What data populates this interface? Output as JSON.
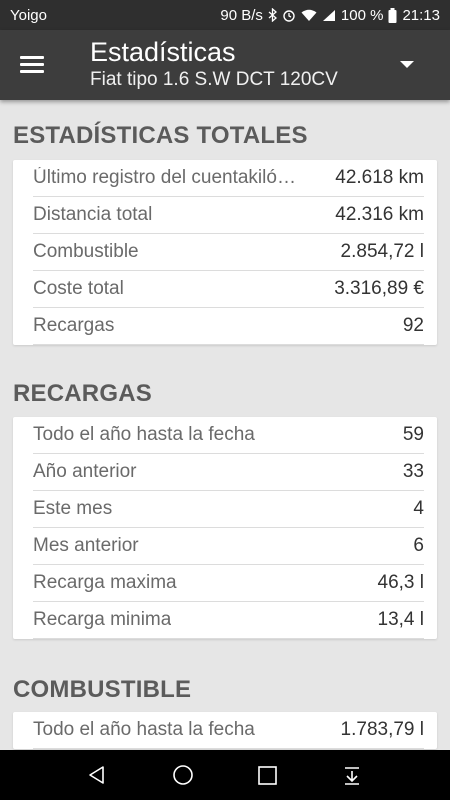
{
  "status_bar": {
    "carrier": "Yoigo",
    "speed": "90 B/s",
    "battery": "100 %",
    "time": "21:13",
    "icons": [
      "bluetooth-icon",
      "alarm-icon",
      "wifi-icon",
      "signal-icon",
      "battery-icon"
    ]
  },
  "app_bar": {
    "title": "Estadísticas",
    "subtitle": "Fiat tipo 1.6 S.W DCT 120CV",
    "menu_icon": "hamburger-menu-icon",
    "dropdown_icon": "dropdown-arrow-icon"
  },
  "sections": {
    "totales": {
      "title": "ESTADÍSTICAS TOTALES",
      "rows": [
        {
          "label": "Último registro del cuentakilómetros",
          "value": "42.618 km"
        },
        {
          "label": "Distancia total",
          "value": "42.316 km"
        },
        {
          "label": "Combustible",
          "value": "2.854,72 l"
        },
        {
          "label": "Coste total",
          "value": "3.316,89 €"
        },
        {
          "label": "Recargas",
          "value": "92"
        }
      ]
    },
    "recargas": {
      "title": "RECARGAS",
      "rows": [
        {
          "label": "Todo el año hasta la fecha",
          "value": "59"
        },
        {
          "label": "Año anterior",
          "value": "33"
        },
        {
          "label": "Este mes",
          "value": "4"
        },
        {
          "label": "Mes anterior",
          "value": "6"
        },
        {
          "label": "Recarga maxima",
          "value": "46,3 l"
        },
        {
          "label": "Recarga minima",
          "value": "13,4 l"
        }
      ]
    },
    "combustible": {
      "title": "COMBUSTIBLE",
      "rows": [
        {
          "label": "Todo el año hasta la fecha",
          "value": "1.783,79 l"
        }
      ]
    }
  },
  "nav_bar": {
    "icons": [
      "back-icon",
      "home-icon",
      "recents-icon",
      "notifications-pull-icon"
    ]
  },
  "colors": {
    "status_bar": "#2f2f2f",
    "app_bar": "#3d3d3d",
    "background": "#e6e6e6",
    "section_title": "#5b5b5b"
  }
}
